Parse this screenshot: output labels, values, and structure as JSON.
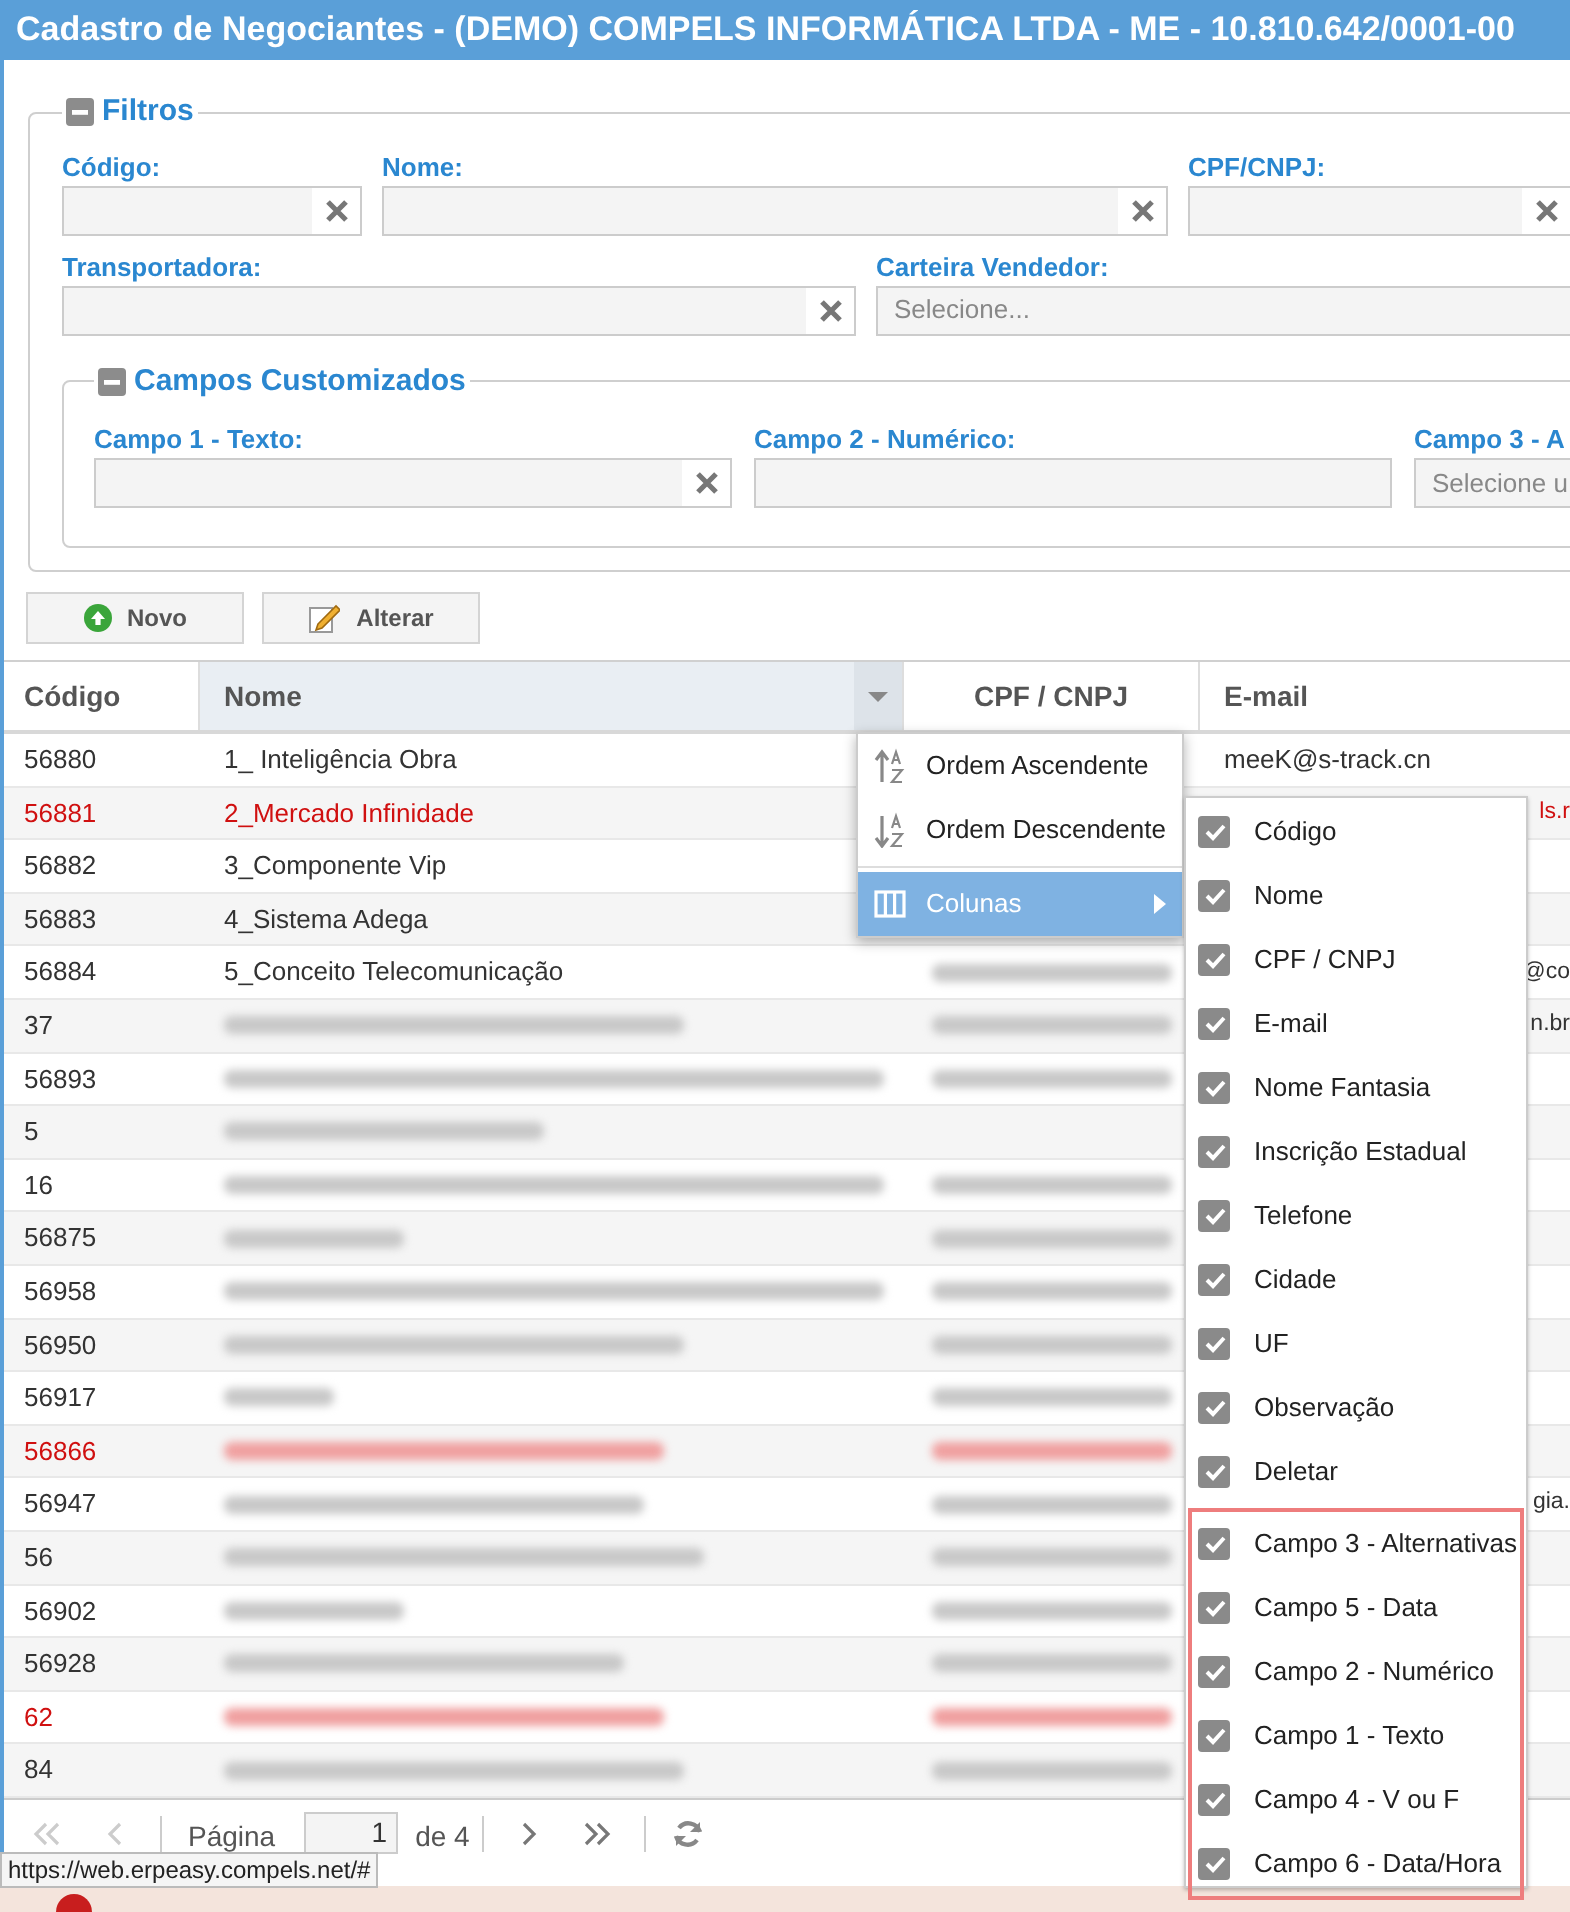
{
  "window": {
    "title": "Cadastro de Negociantes - (DEMO) COMPELS INFORMÁTICA LTDA - ME - 10.810.642/0001-00"
  },
  "filters": {
    "title": "Filtros",
    "rows": [
      [
        {
          "label": "Código:",
          "kind": "text",
          "clearable": true
        },
        {
          "label": "Nome:",
          "kind": "text",
          "clearable": true
        },
        {
          "label": "CPF/CNPJ:",
          "kind": "text",
          "clearable": true
        }
      ],
      [
        {
          "label": "Transportadora:",
          "kind": "text",
          "clearable": true
        },
        {
          "label": "Carteira Vendedor:",
          "kind": "select",
          "placeholder": "Selecione..."
        }
      ]
    ],
    "custom": {
      "title": "Campos Customizados",
      "fields": [
        {
          "label": "Campo 1 - Texto:",
          "kind": "text",
          "clearable": true
        },
        {
          "label": "Campo 2 - Numérico:",
          "kind": "text",
          "clearable": false
        },
        {
          "label": "Campo 3 - A",
          "kind": "select",
          "placeholder": "Selecione u"
        }
      ]
    }
  },
  "buttons": [
    {
      "label": "Novo",
      "kind": "add"
    },
    {
      "label": "Alterar",
      "kind": "edit"
    }
  ],
  "table": {
    "columns": [
      {
        "label": "Código",
        "selected": false
      },
      {
        "label": "Nome",
        "selected": true
      },
      {
        "label": "CPF / CNPJ",
        "selected": false
      },
      {
        "label": "E-mail",
        "selected": false
      }
    ],
    "rows": [
      {
        "code": "56880",
        "name": "1_ Inteligência Obra",
        "alert": false,
        "email": "meeK@s-track.cn",
        "email_clipped": false
      },
      {
        "code": "56881",
        "name": "2_Mercado Infinidade",
        "alert": true,
        "email": "ls.r",
        "email_clipped": true
      },
      {
        "code": "56882",
        "name": "3_Componente Vip",
        "alert": false
      },
      {
        "code": "56883",
        "name": "4_Sistema Adega",
        "alert": false
      },
      {
        "code": "56884",
        "name": "5_Conceito Telecomunicação",
        "alert": false,
        "cpf_masked": true,
        "email": "@co",
        "email_clipped": true
      },
      {
        "code": "37",
        "alert": false,
        "cpf_masked": true,
        "email": "n.br",
        "email_clipped": true
      },
      {
        "code": "56893",
        "alert": false,
        "cpf_masked": true
      },
      {
        "code": "5",
        "alert": false,
        "cpf_masked": false
      },
      {
        "code": "16",
        "alert": false,
        "cpf_masked": true
      },
      {
        "code": "56875",
        "alert": false,
        "cpf_masked": true
      },
      {
        "code": "56958",
        "alert": false,
        "cpf_masked": true
      },
      {
        "code": "56950",
        "alert": false,
        "cpf_masked": true
      },
      {
        "code": "56917",
        "alert": false,
        "cpf_masked": true
      },
      {
        "code": "56866",
        "alert": true,
        "cpf_masked": true
      },
      {
        "code": "56947",
        "alert": false,
        "cpf_masked": true,
        "email": "gia.",
        "email_clipped": true
      },
      {
        "code": "56",
        "alert": false,
        "cpf_masked": true
      },
      {
        "code": "56902",
        "alert": false,
        "cpf_masked": true
      },
      {
        "code": "56928",
        "alert": false,
        "cpf_masked": true
      },
      {
        "code": "62",
        "alert": true,
        "cpf_masked": true
      },
      {
        "code": "84",
        "alert": false,
        "cpf_masked": true
      }
    ]
  },
  "context_menu": {
    "items": [
      {
        "label": "Ordem Ascendente",
        "kind": "sort-asc",
        "selected": false
      },
      {
        "label": "Ordem Descendente",
        "kind": "sort-desc",
        "selected": false
      },
      {
        "label": "Colunas",
        "kind": "submenu",
        "selected": true
      }
    ]
  },
  "columns_menu": {
    "items": [
      {
        "label": "Código",
        "checked": true
      },
      {
        "label": "Nome",
        "checked": true
      },
      {
        "label": "CPF / CNPJ",
        "checked": true
      },
      {
        "label": "E-mail",
        "checked": true
      },
      {
        "label": "Nome Fantasia",
        "checked": true
      },
      {
        "label": "Inscrição Estadual",
        "checked": true
      },
      {
        "label": "Telefone",
        "checked": true
      },
      {
        "label": "Cidade",
        "checked": true
      },
      {
        "label": "UF",
        "checked": true
      },
      {
        "label": "Observação",
        "checked": true
      },
      {
        "label": "Deletar",
        "checked": true
      }
    ],
    "custom_items": [
      {
        "label": "Campo 3 - Alternativas",
        "checked": true
      },
      {
        "label": "Campo 5 - Data",
        "checked": true
      },
      {
        "label": "Campo 2 - Numérico",
        "checked": true
      },
      {
        "label": "Campo 1 - Texto",
        "checked": true
      },
      {
        "label": "Campo 4 - V ou F",
        "checked": true
      },
      {
        "label": "Campo 6 - Data/Hora",
        "checked": true
      }
    ]
  },
  "pager": {
    "page_label": "Página",
    "page": "1",
    "page_count": "de 4"
  },
  "status_url": "https://web.erpeasy.compels.net/#"
}
